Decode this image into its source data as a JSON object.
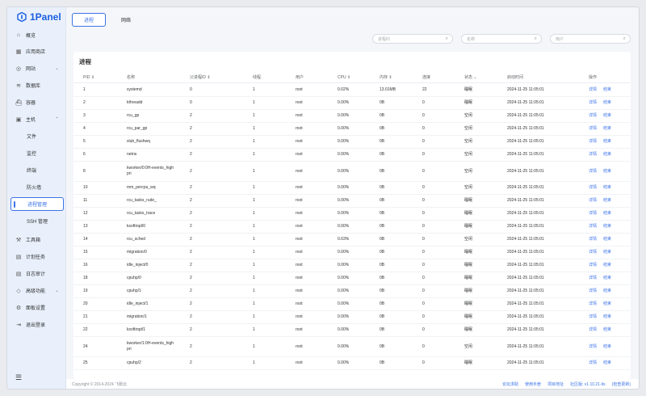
{
  "app": {
    "name": "1Panel"
  },
  "sidebar": {
    "items": [
      {
        "label": "概览",
        "icon": "home-icon"
      },
      {
        "label": "应用商店",
        "icon": "grid-icon"
      },
      {
        "label": "网站",
        "icon": "globe-icon",
        "chev": "⌄"
      },
      {
        "label": "数据库",
        "icon": "database-icon"
      },
      {
        "label": "容器",
        "icon": "container-icon"
      },
      {
        "label": "主机",
        "icon": "host-icon",
        "chev": "⌃"
      },
      {
        "label": "文件",
        "sub": true
      },
      {
        "label": "监控",
        "sub": true
      },
      {
        "label": "终端",
        "sub": true
      },
      {
        "label": "防火墙",
        "sub": true
      },
      {
        "label": "进程管理",
        "sub": true,
        "active": true
      },
      {
        "label": "SSH 管理",
        "sub": true
      },
      {
        "label": "工具箱",
        "icon": "toolbox-icon"
      },
      {
        "label": "计划任务",
        "icon": "calendar-icon"
      },
      {
        "label": "日志审计",
        "icon": "log-icon"
      },
      {
        "label": "高级功能",
        "icon": "diamond-icon",
        "chev": "⌄"
      },
      {
        "label": "面板设置",
        "icon": "settings-icon"
      },
      {
        "label": "退出登录",
        "icon": "logout-icon"
      }
    ]
  },
  "tabs": [
    {
      "label": "进程",
      "active": true
    },
    {
      "label": "网络"
    }
  ],
  "filters": {
    "pid": "进程ID",
    "name": "名称",
    "user": "用户"
  },
  "panel": {
    "title": "进程"
  },
  "table": {
    "headers": [
      "PID ⇕",
      "名称",
      "父进程ID ⇕",
      "线程",
      "用户",
      "CPU ⇕",
      "内存 ⇕",
      "连接",
      "状态 ⌄",
      "启动时间",
      "操作"
    ],
    "action_detail": "详情",
    "action_end": "结束",
    "rows": [
      [
        "1",
        "systemd",
        "0",
        "1",
        "root",
        "0.02%",
        "13.01MB",
        "22",
        "睡眠",
        "2024-11-25 11:05:01"
      ],
      [
        "2",
        "kthreadd",
        "0",
        "1",
        "root",
        "0.00%",
        "0B",
        "0",
        "睡眠",
        "2024-11-25 11:05:01"
      ],
      [
        "3",
        "rcu_gp",
        "2",
        "1",
        "root",
        "0.00%",
        "0B",
        "0",
        "空闲",
        "2024-11-25 11:05:01"
      ],
      [
        "4",
        "rcu_par_gp",
        "2",
        "1",
        "root",
        "0.00%",
        "0B",
        "0",
        "空闲",
        "2024-11-25 11:05:01"
      ],
      [
        "5",
        "slub_flushwq",
        "2",
        "1",
        "root",
        "0.00%",
        "0B",
        "0",
        "空闲",
        "2024-11-25 11:05:01"
      ],
      [
        "6",
        "netns",
        "2",
        "1",
        "root",
        "0.00%",
        "0B",
        "0",
        "空闲",
        "2024-11-25 11:05:01"
      ],
      [
        "8",
        "kworker/0:0H-events_highpri",
        "2",
        "1",
        "root",
        "0.00%",
        "0B",
        "0",
        "空闲",
        "2024-11-25 11:05:01"
      ],
      [
        "10",
        "mm_percpu_wq",
        "2",
        "1",
        "root",
        "0.00%",
        "0B",
        "0",
        "空闲",
        "2024-11-25 11:05:01"
      ],
      [
        "11",
        "rcu_tasks_rude_",
        "2",
        "1",
        "root",
        "0.00%",
        "0B",
        "0",
        "睡眠",
        "2024-11-25 11:05:01"
      ],
      [
        "12",
        "rcu_tasks_trace",
        "2",
        "1",
        "root",
        "0.00%",
        "0B",
        "0",
        "睡眠",
        "2024-11-25 11:05:01"
      ],
      [
        "13",
        "ksoftirqd/0",
        "2",
        "1",
        "root",
        "0.00%",
        "0B",
        "0",
        "睡眠",
        "2024-11-25 11:05:01"
      ],
      [
        "14",
        "rcu_sched",
        "2",
        "1",
        "root",
        "0.03%",
        "0B",
        "0",
        "空闲",
        "2024-11-25 11:05:01"
      ],
      [
        "15",
        "migration/0",
        "2",
        "1",
        "root",
        "0.00%",
        "0B",
        "0",
        "睡眠",
        "2024-11-25 11:05:01"
      ],
      [
        "16",
        "idle_inject/0",
        "2",
        "1",
        "root",
        "0.00%",
        "0B",
        "0",
        "睡眠",
        "2024-11-25 11:05:01"
      ],
      [
        "18",
        "cpuhp/0",
        "2",
        "1",
        "root",
        "0.00%",
        "0B",
        "0",
        "睡眠",
        "2024-11-25 11:05:01"
      ],
      [
        "19",
        "cpuhp/1",
        "2",
        "1",
        "root",
        "0.00%",
        "0B",
        "0",
        "睡眠",
        "2024-11-25 11:05:01"
      ],
      [
        "20",
        "idle_inject/1",
        "2",
        "1",
        "root",
        "0.00%",
        "0B",
        "0",
        "睡眠",
        "2024-11-25 11:05:01"
      ],
      [
        "21",
        "migration/1",
        "2",
        "1",
        "root",
        "0.00%",
        "0B",
        "0",
        "睡眠",
        "2024-11-25 11:05:01"
      ],
      [
        "22",
        "ksoftirqd/1",
        "2",
        "1",
        "root",
        "0.00%",
        "0B",
        "0",
        "睡眠",
        "2024-11-25 11:05:01"
      ],
      [
        "24",
        "kworker/1:0H-events_highpri",
        "2",
        "1",
        "root",
        "0.00%",
        "0B",
        "0",
        "空闲",
        "2024-11-25 11:05:01"
      ],
      [
        "25",
        "cpuhp/2",
        "2",
        "1",
        "root",
        "0.00%",
        "0B",
        "0",
        "睡眠",
        "2024-11-25 11:05:01"
      ]
    ]
  },
  "footer": {
    "copyright": "Copyright © 2014-2024 飞致云",
    "links": [
      "论坛求助",
      "使用手册",
      "项目地址",
      "社区版: v1.10.21-lts",
      "(检查更新)"
    ]
  }
}
